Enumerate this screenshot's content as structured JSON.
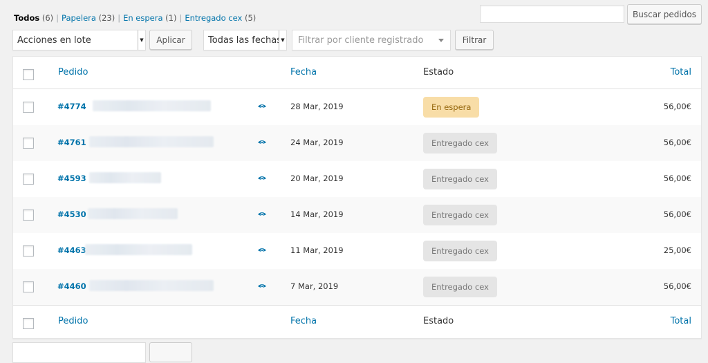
{
  "status_filters": [
    {
      "label": "Todos",
      "count": "(6)",
      "current": true
    },
    {
      "label": "Papelera",
      "count": "(23)",
      "current": false
    },
    {
      "label": "En espera",
      "count": "(1)",
      "current": false
    },
    {
      "label": "Entregado cex",
      "count": "(5)",
      "current": false
    }
  ],
  "search": {
    "value": "",
    "button_label": "Buscar pedidos"
  },
  "toolbar": {
    "bulk_action": "Acciones en lote",
    "apply_label": "Aplicar",
    "date_filter": "Todas las fechas",
    "customer_placeholder": "Filtrar por cliente registrado",
    "filter_label": "Filtrar"
  },
  "columns": {
    "order": "Pedido",
    "date": "Fecha",
    "status": "Estado",
    "total": "Total"
  },
  "orders": [
    {
      "number": "#4774",
      "date": "28 Mar, 2019",
      "status": "En espera",
      "status_type": "on-hold",
      "total": "56,00€"
    },
    {
      "number": "#4761",
      "date": "24 Mar, 2019",
      "status": "Entregado cex",
      "status_type": "delivered",
      "total": "56,00€"
    },
    {
      "number": "#4593",
      "date": "20 Mar, 2019",
      "status": "Entregado cex",
      "status_type": "delivered",
      "total": "56,00€"
    },
    {
      "number": "#4530",
      "date": "14 Mar, 2019",
      "status": "Entregado cex",
      "status_type": "delivered",
      "total": "56,00€"
    },
    {
      "number": "#4463",
      "date": "11 Mar, 2019",
      "status": "Entregado cex",
      "status_type": "delivered",
      "total": "25,00€"
    },
    {
      "number": "#4460",
      "date": "7 Mar, 2019",
      "status": "Entregado cex",
      "status_type": "delivered",
      "total": "56,00€"
    }
  ],
  "colors": {
    "link": "#0073aa",
    "on_hold_bg": "#f8dda7",
    "on_hold_text": "#94660c",
    "delivered_bg": "#e5e5e5"
  },
  "icons": {
    "preview": "eye-icon",
    "dropdown": "chevron-down-icon"
  }
}
